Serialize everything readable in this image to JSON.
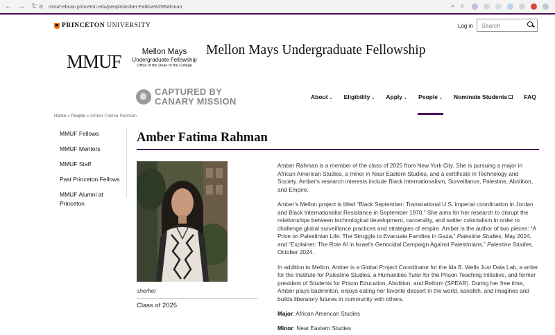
{
  "browser": {
    "url": "mmuf-ebcao.princeton.edu/people/amber-Fatima%20Rahman"
  },
  "header": {
    "university_logo_prefix": "PRINCETON",
    "university_logo_suffix": "UNIVERSITY",
    "login_label": "Log in",
    "search_placeholder": "Search",
    "mmuf_acronym": "MMUF",
    "mellon_line1": "Mellon Mays",
    "mellon_line2": "Undergraduate Fellowship",
    "mellon_line3": "Office of the Dean of the College",
    "site_title": "Mellon Mays Undergraduate Fellowship"
  },
  "overlay": {
    "line1": "CAPTURED BY",
    "line2": "CANARY MISSION"
  },
  "nav": {
    "about": "About",
    "eligibility": "Eligibility",
    "apply": "Apply",
    "people": "People",
    "nominate": "Nominate Students",
    "faq": "FAQ"
  },
  "breadcrumb": {
    "home": "Home",
    "sep": "»",
    "people": "People",
    "current": "Amber Fatima Rahman"
  },
  "sidebar": {
    "items": [
      {
        "label": "MMUF Fellows"
      },
      {
        "label": "MMUF Mentors"
      },
      {
        "label": "MMUF Staff"
      },
      {
        "label": "Past Princeton Fellows"
      },
      {
        "label": "MMUF Alumni at Princeton"
      }
    ]
  },
  "profile": {
    "name": "Amber Fatima Rahman",
    "pronouns": "she/her",
    "class_year": "Class of 2025",
    "bio_p1": "Amber Rahman is a member of the class of 2025 from New York City. She is pursuing a major in African American Studies, a minor in Near Eastern Studies, and a certificate in Technology and Society. Amber's research interests include Black Internationalism, Surveillance, Palestine, Abolition, and Empire.",
    "bio_p2_a": "Amber's Mellon project is titled “Black September: Transnational U.S. imperial coordination in Jordan and Black Internationalist Resistance in September 1970.” She aims for her research to disrupt the relationships between technological development, carcerality, and settler colonialism in order to challenge global surveillance practices and strategies of empire. Amber is the author of two pieces: “A Price on Palestinian Life: The Struggle to Evacuate Families in Gaza,”",
    "bio_p2_pub1": "Palestine Studies,",
    "bio_p2_b": "May 2024, and “Explainer: The Role AI in Israel's Genocidal Campaign Against Palestinians,”",
    "bio_p2_pub2": "Palestine Studies,",
    "bio_p2_c": "October 2024.",
    "bio_p3": "In addition to Mellon, Amber is a Global Project Coordinator for the Ida B. Wells Just Data Lab, a writer for the Institute for Palestine Studies, a Humanities Tutor for the Prison Teaching Initiative, and former president of Students for Prison Education, Abolition, and Reform (SPEAR). During her free time, Amber plays badminton, enjoys eating her favorite dessert in the world, kanafeh, and imagines and builds liberatory futures in community with others.",
    "major_label": "Major",
    "major_value": ": African American Studies",
    "minor_label": "Minor",
    "minor_value": ": Near Eastern Studies"
  },
  "colors": {
    "brand_purple": "#4b0f5a",
    "princeton_orange": "#e8720c"
  }
}
